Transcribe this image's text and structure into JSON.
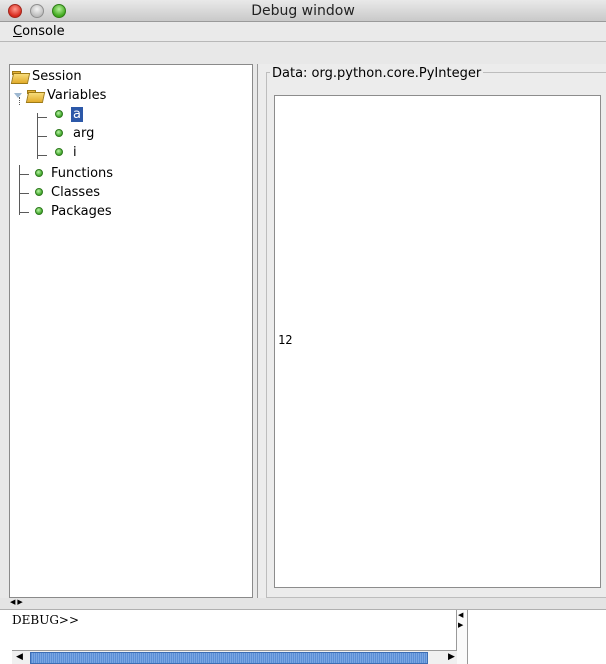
{
  "window": {
    "title": "Debug window"
  },
  "menu": {
    "console_label_first": "C",
    "console_label_rest": "onsole"
  },
  "tree": {
    "session": "Session",
    "variables": "Variables",
    "var_a": "a",
    "var_arg": "arg",
    "var_i": "i",
    "functions": "Functions",
    "classes": "Classes",
    "packages": "Packages"
  },
  "data_panel": {
    "legend": "Data: org.python.core.PyInteger",
    "value": "12"
  },
  "console": {
    "prompt": "DEBUG>>"
  },
  "colors": {
    "selection": "#2c58a8",
    "dot_green": "#40a62a",
    "folder": "#e2ac2b"
  }
}
